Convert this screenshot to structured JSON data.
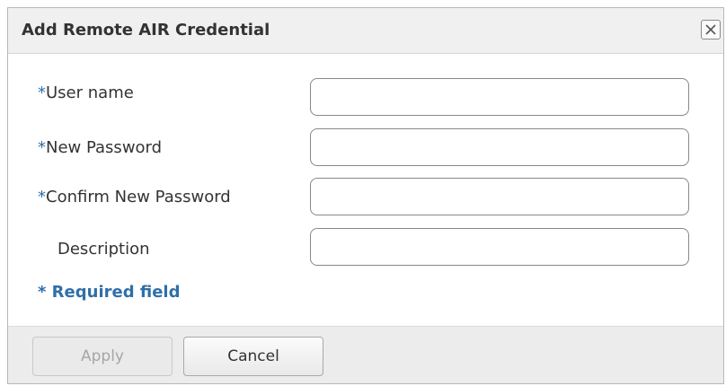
{
  "dialog": {
    "title": "Add Remote AIR Credential",
    "close_icon": "close-icon"
  },
  "form": {
    "required_marker": "*",
    "fields": [
      {
        "label": "User name",
        "required": true,
        "value": ""
      },
      {
        "label": "New Password",
        "required": true,
        "value": ""
      },
      {
        "label": "Confirm New Password",
        "required": true,
        "value": ""
      },
      {
        "label": "Description",
        "required": false,
        "value": ""
      }
    ],
    "required_note": "* Required field"
  },
  "footer": {
    "apply_label": "Apply",
    "apply_disabled": true,
    "cancel_label": "Cancel"
  },
  "colors": {
    "accent_blue": "#2f6fa8",
    "title_bar": "#f0f0f0",
    "footer_bar": "#ececec",
    "disabled_text": "#a6a6a6"
  }
}
